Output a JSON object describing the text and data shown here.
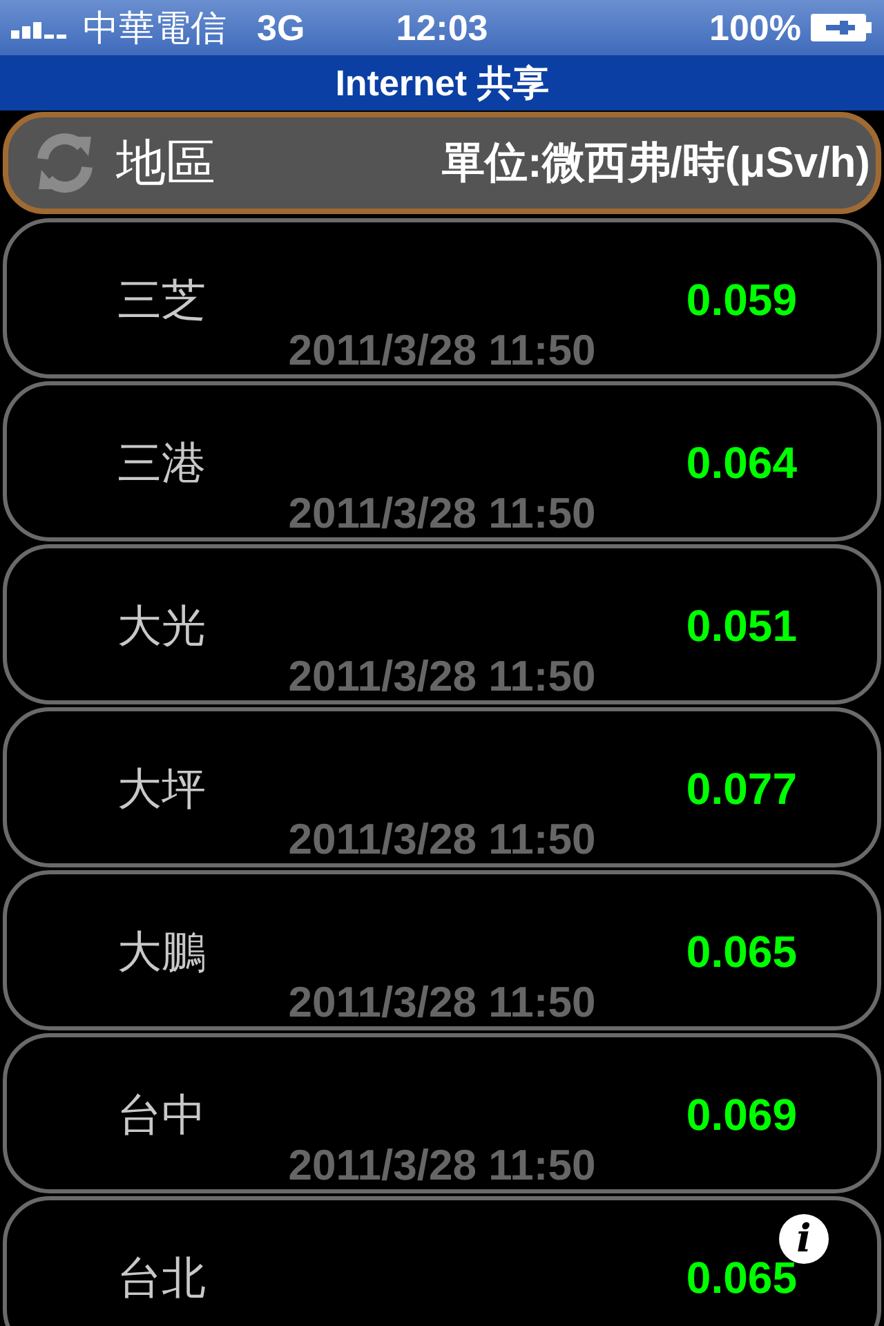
{
  "status_bar": {
    "carrier": "中華電信",
    "network": "3G",
    "time": "12:03",
    "battery": "100%"
  },
  "nav_bar": {
    "title": "Internet 共享"
  },
  "header": {
    "region_label": "地區",
    "unit_label": "單位:微西弗/時(μSv/h)"
  },
  "stations": [
    {
      "name": "三芝",
      "value": "0.059",
      "date": "2011/3/28 11:50"
    },
    {
      "name": "三港",
      "value": "0.064",
      "date": "2011/3/28 11:50"
    },
    {
      "name": "大光",
      "value": "0.051",
      "date": "2011/3/28 11:50"
    },
    {
      "name": "大坪",
      "value": "0.077",
      "date": "2011/3/28 11:50"
    },
    {
      "name": "大鵬",
      "value": "0.065",
      "date": "2011/3/28 11:50"
    },
    {
      "name": "台中",
      "value": "0.069",
      "date": "2011/3/28 11:50"
    },
    {
      "name": "台北",
      "value": "0.065"
    }
  ],
  "info_button": {
    "label": "i"
  }
}
